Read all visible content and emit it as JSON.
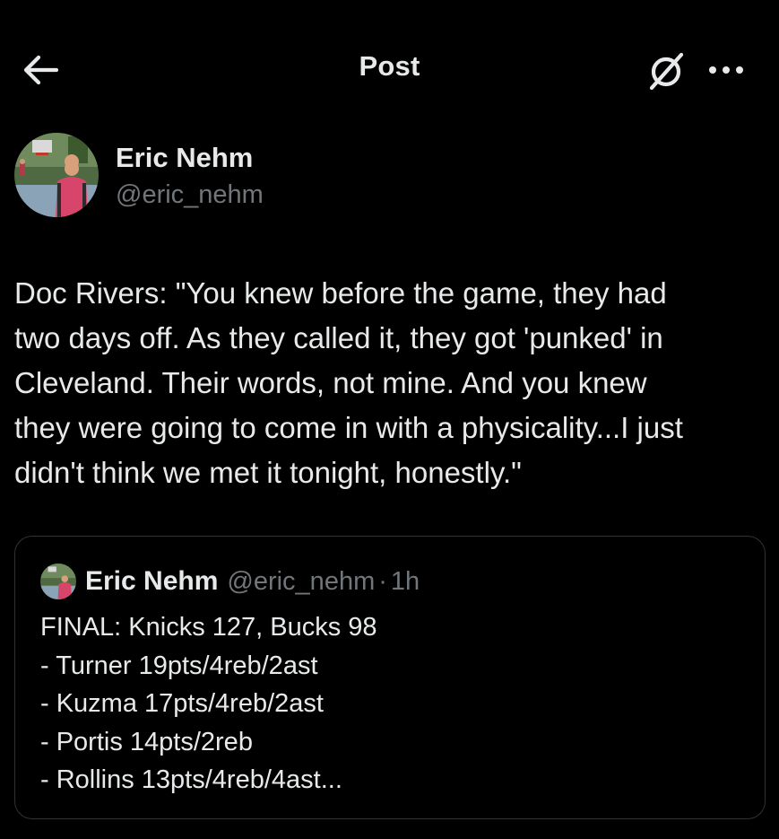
{
  "header": {
    "title": "Post",
    "back_icon": "arrow-left-icon",
    "grok_icon": "grok-slash-circle-icon",
    "more_icon": "more-horizontal-icon"
  },
  "author": {
    "name": "Eric Nehm",
    "handle": "@eric_nehm"
  },
  "post": {
    "text": "Doc Rivers: \"You knew before the game, they had\ntwo days off. As they called it, they got 'punked' in\nCleveland. Their words, not mine. And you knew\nthey were going to come in with a physicality...I just\ndidn't think we met it tonight, honestly.\""
  },
  "quote": {
    "name": "Eric Nehm",
    "handle": "@eric_nehm",
    "separator": "·",
    "time": "1h",
    "text": "FINAL: Knicks 127, Bucks 98\n- Turner 19pts/4reb/2ast\n- Kuzma 17pts/4reb/2ast\n- Portis 14pts/2reb\n- Rollins 13pts/4reb/4ast..."
  },
  "colors": {
    "background": "#000000",
    "primary_text": "#e7e9ea",
    "secondary_text": "#71767b",
    "border": "#2f3336"
  }
}
